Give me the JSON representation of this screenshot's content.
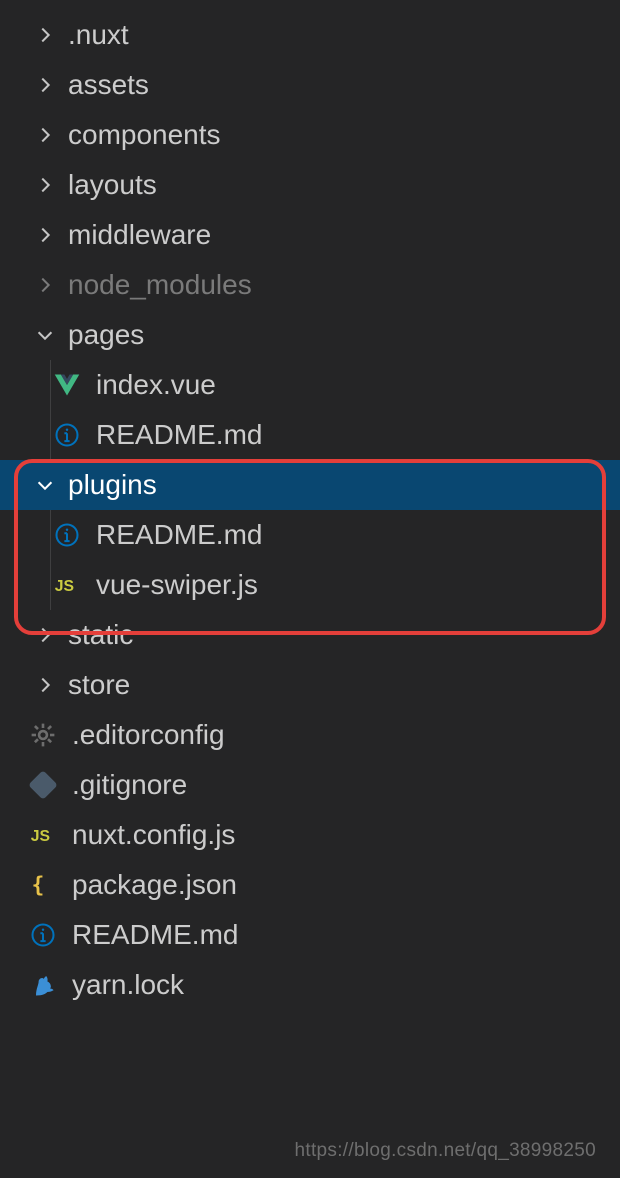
{
  "tree": {
    "nuxt_dir": ".nuxt",
    "assets": "assets",
    "components": "components",
    "layouts": "layouts",
    "middleware": "middleware",
    "node_modules": "node_modules",
    "pages": "pages",
    "pages_children": {
      "index_vue": "index.vue",
      "readme": "README.md"
    },
    "plugins": "plugins",
    "plugins_children": {
      "readme": "README.md",
      "vue_swiper": "vue-swiper.js"
    },
    "static": "static",
    "store": "store",
    "editorconfig": ".editorconfig",
    "gitignore": ".gitignore",
    "nuxt_config": "nuxt.config.js",
    "package_json": "package.json",
    "readme_root": "README.md",
    "yarn_lock": "yarn.lock"
  },
  "watermark": "https://blog.csdn.net/qq_38998250"
}
